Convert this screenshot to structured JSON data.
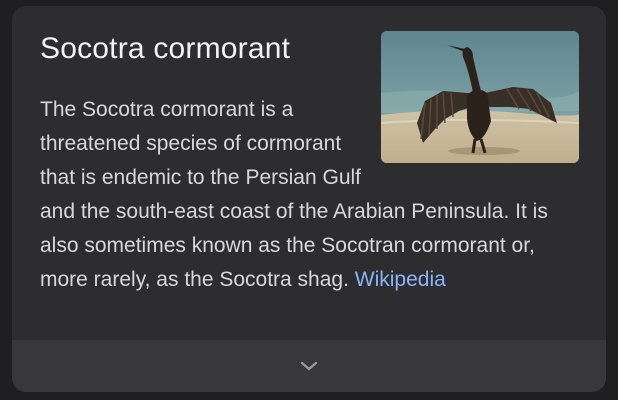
{
  "card": {
    "title": "Socotra cormorant",
    "description": "The Socotra cormorant is a threatened species of cormorant that is endemic to the Persian Gulf and the south-east coast of the Arabian Peninsula. It is also sometimes known as the Socotran cormorant or, more rarely, as the Socotra shag.",
    "source_link_label": "Wikipedia",
    "image_icon": "bird-photo",
    "expand_icon": "chevron-down-icon"
  },
  "colors": {
    "background": "#1f1f21",
    "card": "#2d2d2f",
    "expander": "#38383a",
    "title": "#f2f2f2",
    "text": "#d8d8d8",
    "link": "#8ab4f8"
  }
}
